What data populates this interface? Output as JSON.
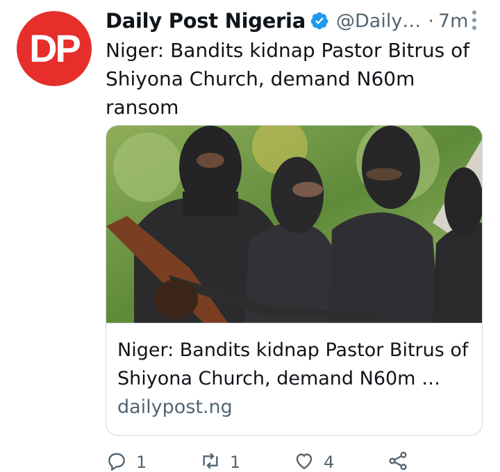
{
  "tweet": {
    "avatar_text": "DP",
    "author_name": "Daily Post Nigeria",
    "handle": "@Daily…",
    "separator": "·",
    "time": "7m",
    "text": "Niger: Bandits kidnap Pastor Bitrus of Shiyona Church, demand N60m ransom"
  },
  "card": {
    "title": "Niger: Bandits kidnap Pastor Bitrus of Shiyona Church, demand N60m …",
    "domain": "dailypost.ng"
  },
  "actions": {
    "reply_count": "1",
    "retweet_count": "1",
    "like_count": "4"
  },
  "colors": {
    "avatar_bg": "#e62e2b",
    "verified_blue": "#1d9bf0",
    "secondary_text": "#536471"
  }
}
